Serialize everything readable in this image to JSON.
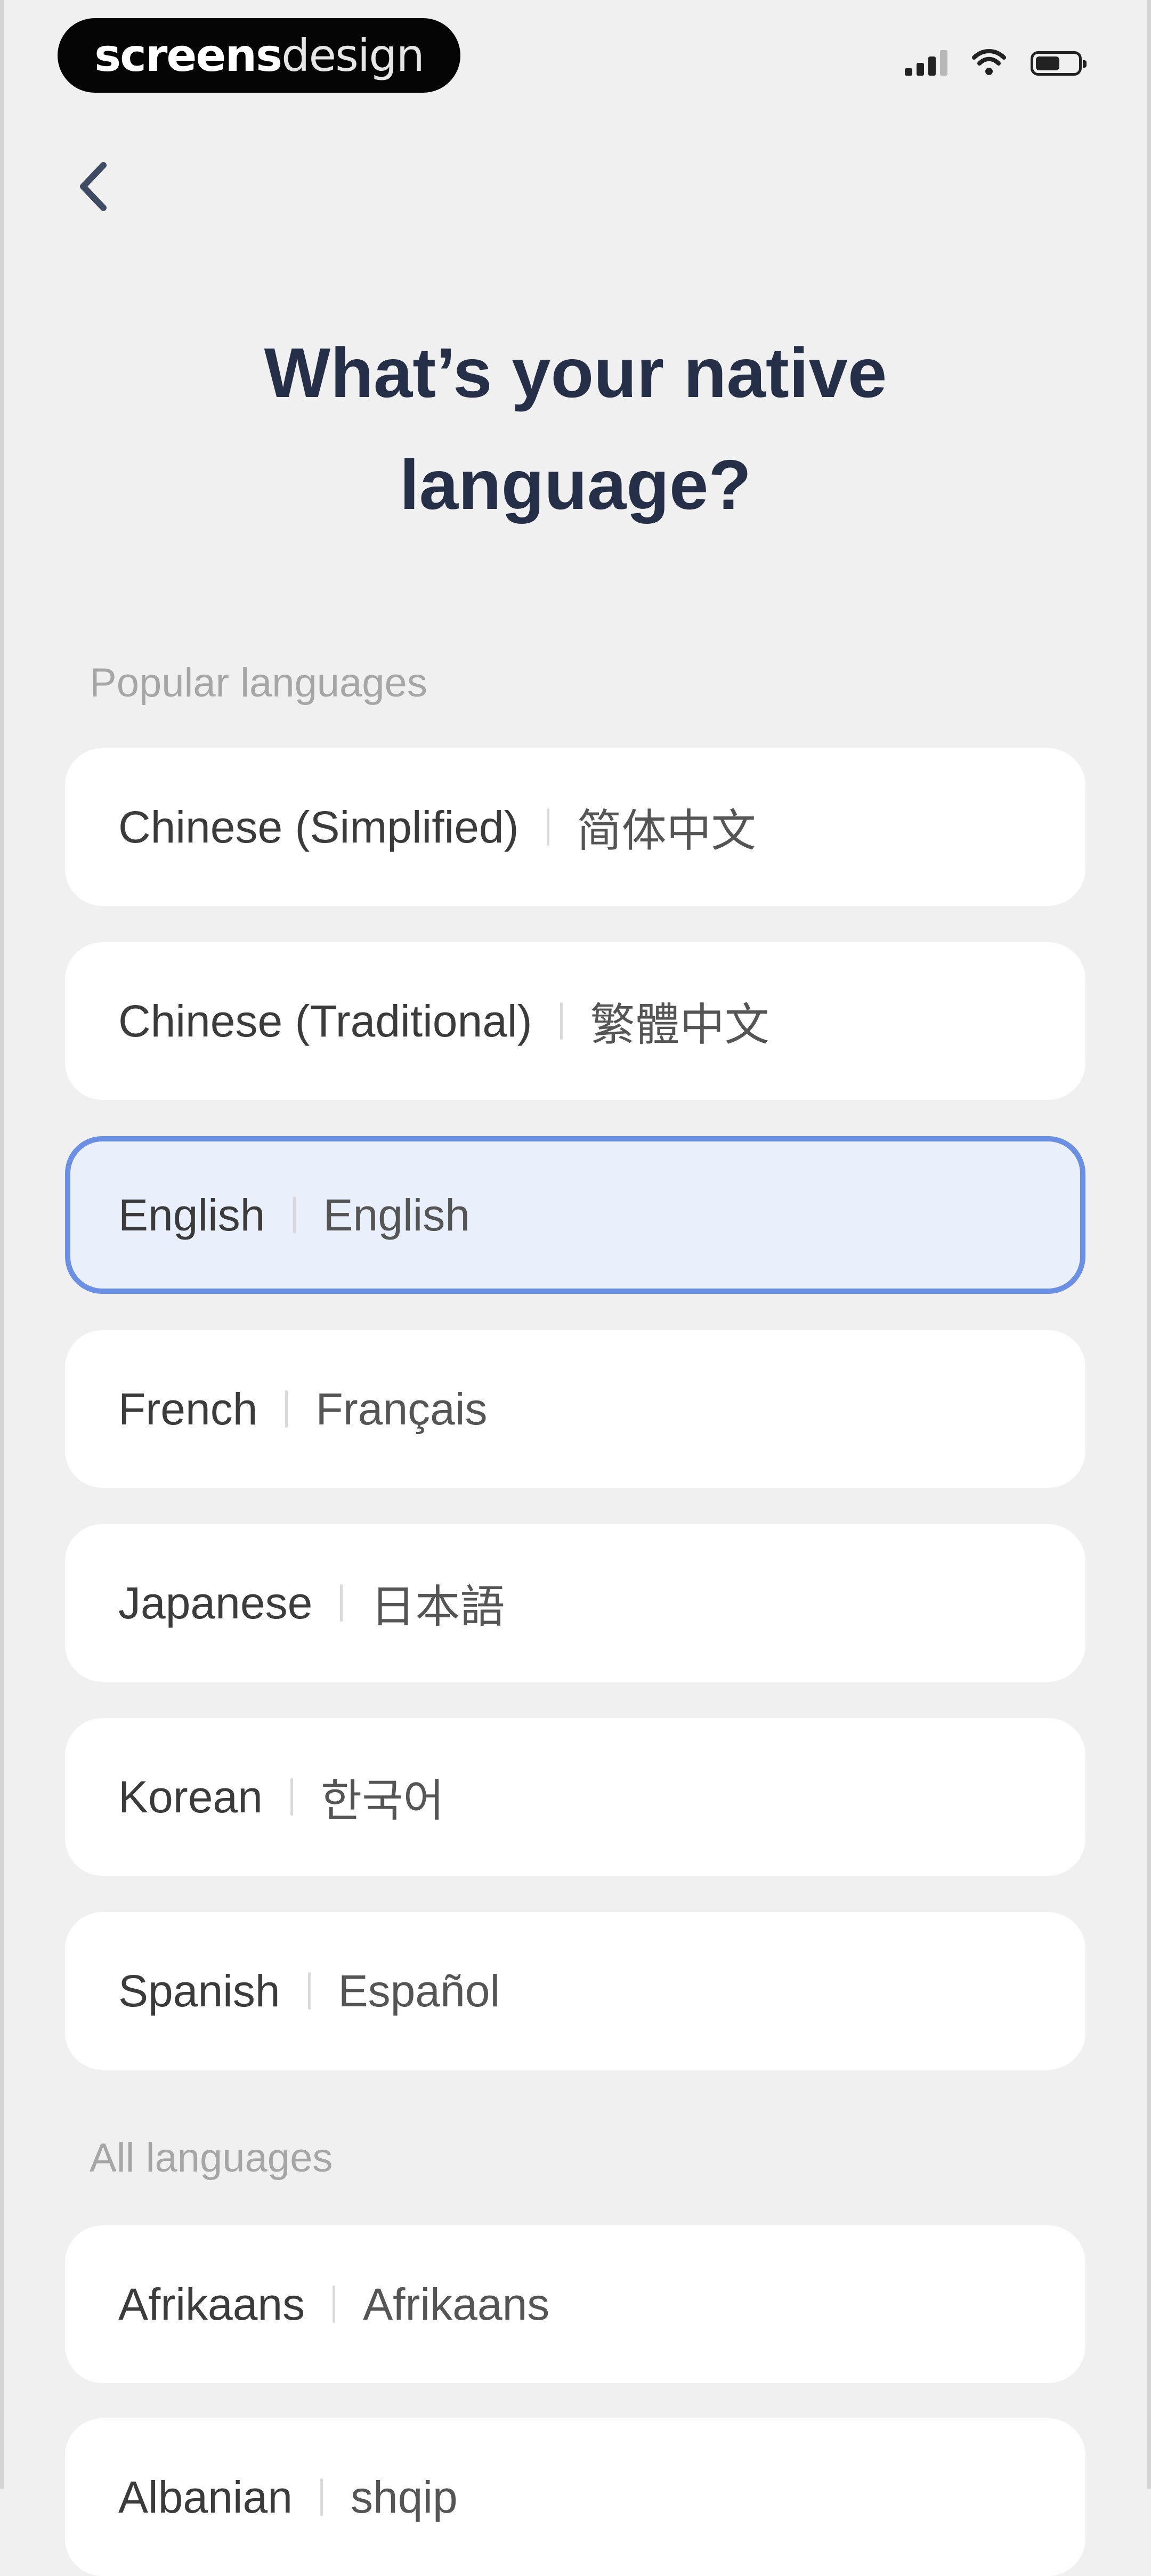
{
  "status_bar": {
    "brand_bold": "screens",
    "brand_light": "design",
    "icons": [
      "signal-icon",
      "wifi-icon",
      "battery-icon"
    ]
  },
  "header": {
    "back_icon": "chevron-left-icon",
    "title": "What’s your native language?"
  },
  "popular": {
    "label": "Popular languages",
    "items": [
      {
        "name": "Chinese (Simplified)",
        "native": "简体中文",
        "selected": false
      },
      {
        "name": "Chinese (Traditional)",
        "native": "繁體中文",
        "selected": false
      },
      {
        "name": "English",
        "native": "English",
        "selected": true
      },
      {
        "name": "French",
        "native": "Français",
        "selected": false
      },
      {
        "name": "Japanese",
        "native": "日本語",
        "selected": false
      },
      {
        "name": "Korean",
        "native": "한국어",
        "selected": false
      },
      {
        "name": "Spanish",
        "native": "Español",
        "selected": false
      }
    ]
  },
  "all": {
    "label": "All languages",
    "items": [
      {
        "name": "Afrikaans",
        "native": "Afrikaans",
        "selected": false
      },
      {
        "name": "Albanian",
        "native": "shqip",
        "selected": false
      }
    ]
  },
  "colors": {
    "background": "#f0f0f0",
    "title": "#252f47",
    "selected_border": "#6b8fe3",
    "selected_fill": "#e9effb",
    "section_label": "#a6a6a6"
  }
}
